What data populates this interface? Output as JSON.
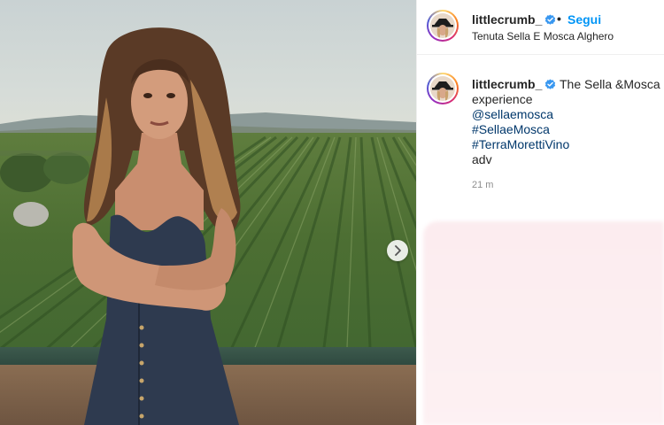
{
  "post": {
    "username": "littlecrumb_",
    "verified": true,
    "separator": "•",
    "follow_label": "Segui",
    "location": "Tenuta Sella E Mosca Alghero"
  },
  "caption": {
    "username": "littlecrumb_",
    "text_lines": [
      "The Sella &Mosca",
      "experience"
    ],
    "links": [
      "@sellaemosca",
      "#SellaeMosca",
      "#TerraMorettiVino"
    ],
    "tail": "adv",
    "timestamp": "21 m"
  },
  "icons": {
    "verified": "verified-badge-icon",
    "next": "chevron-right-icon"
  },
  "colors": {
    "follow": "#0095f6",
    "link": "#00376b",
    "verified": "#3897f0",
    "muted": "#8e8e8e"
  }
}
